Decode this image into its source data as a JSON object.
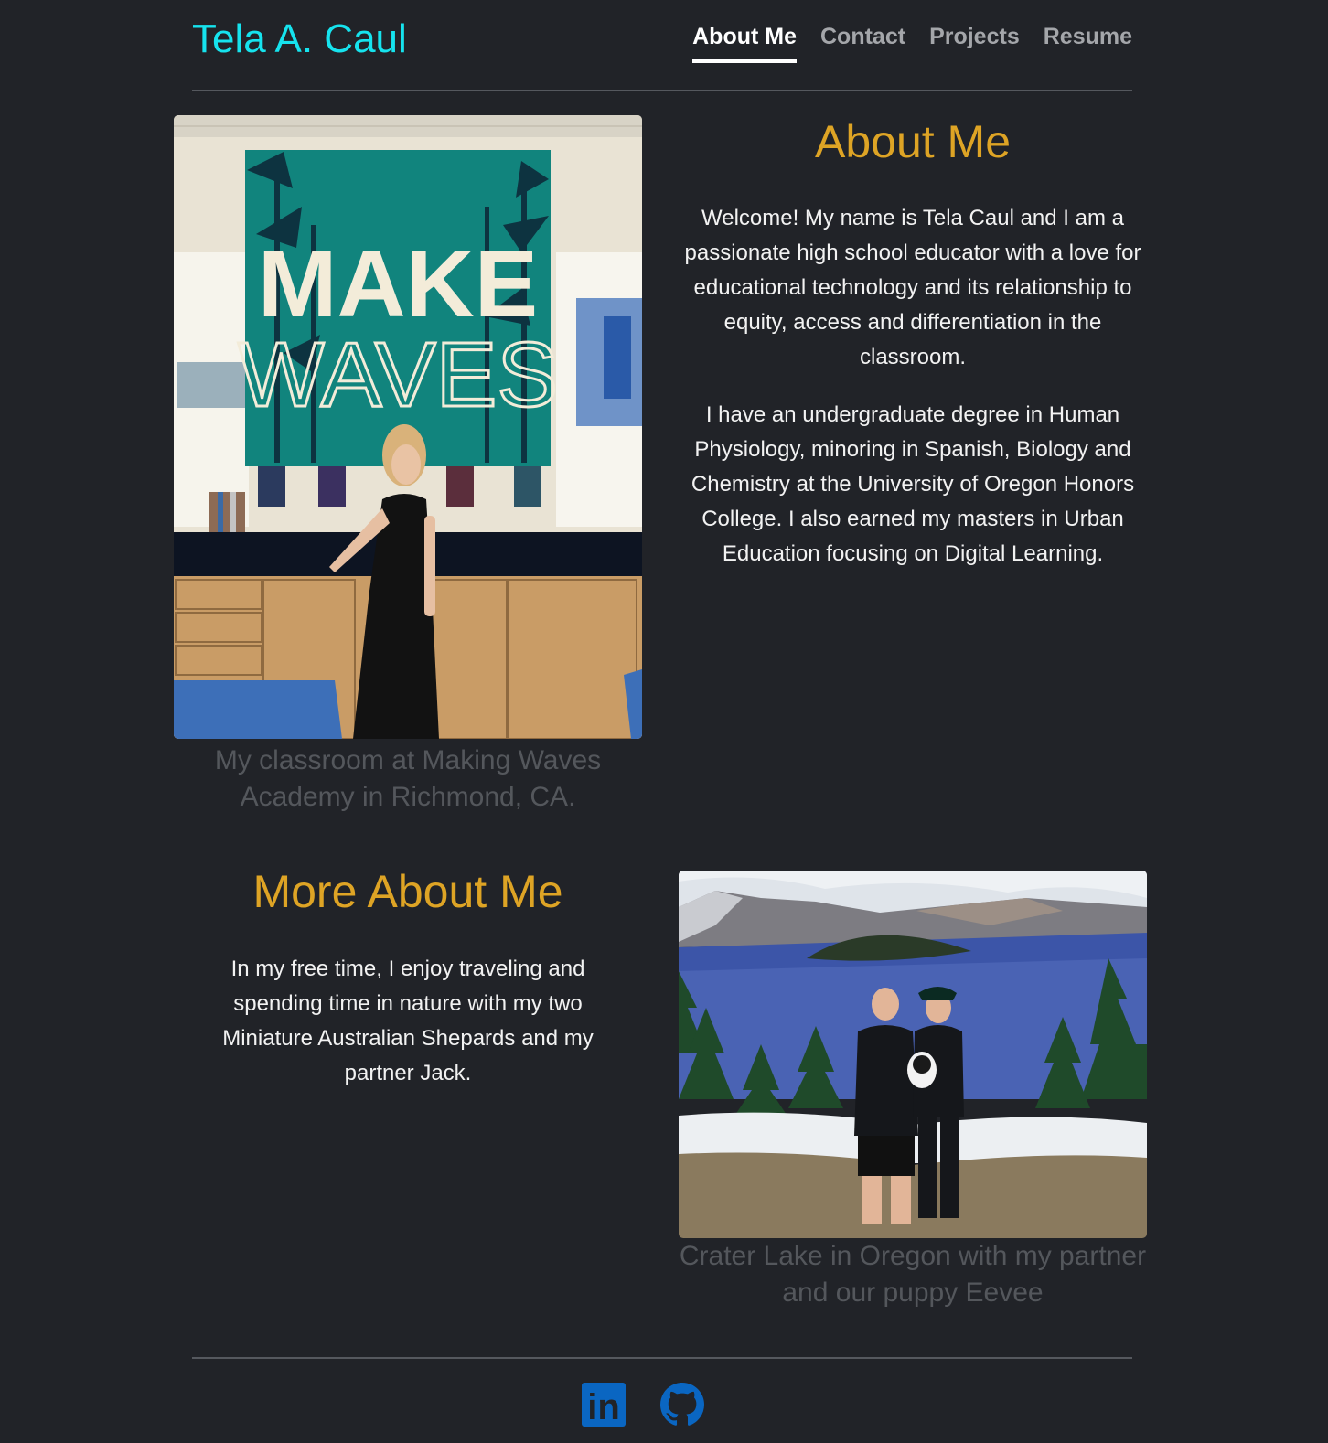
{
  "header": {
    "brand": "Tela A. Caul",
    "nav": [
      {
        "label": "About Me",
        "active": true
      },
      {
        "label": "Contact",
        "active": false
      },
      {
        "label": "Projects",
        "active": false
      },
      {
        "label": "Resume",
        "active": false
      }
    ]
  },
  "about": {
    "title": "About Me",
    "paragraphs": [
      "Welcome! My name is Tela Caul and I am a passionate high school educator with a love for educational technology and its relationship to equity, access and differentiation in the classroom.",
      "I have an undergraduate degree in Human Physiology, minoring in Spanish, Biology and Chemistry at the University of Oregon Honors College. I also earned my masters in Urban Education focusing on Digital Learning."
    ],
    "image": {
      "banner_line1": "MAKE",
      "banner_line2": "WAVES",
      "caption": "My classroom at Making Waves Academy in Richmond, CA."
    }
  },
  "more": {
    "title": "More About Me",
    "paragraph": "In my free time, I enjoy traveling and spending time in nature with my two Miniature Australian Shepards and my partner Jack.",
    "image": {
      "caption": "Crater Lake in Oregon with my partner and our puppy Eevee"
    }
  },
  "footer": {
    "icons": [
      {
        "name": "linkedin-icon",
        "text": "in",
        "color": "#0a66c2"
      },
      {
        "name": "github-icon",
        "color": "#0a66c2"
      }
    ]
  },
  "colors": {
    "background": "#212328",
    "brand": "#16e3ee",
    "heading": "#dea425",
    "caption": "#54575c",
    "rule": "#55585e"
  }
}
